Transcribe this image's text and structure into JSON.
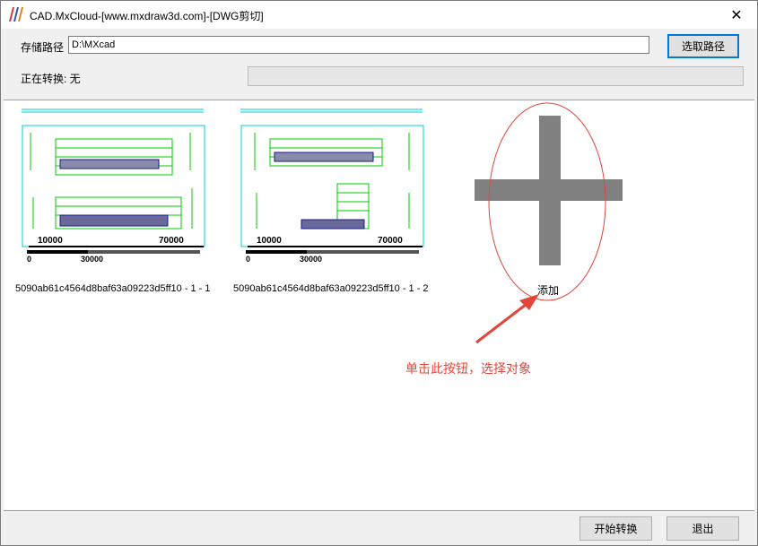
{
  "window": {
    "title": "CAD.MxCloud-[www.mxdraw3d.com]-[DWG剪切]",
    "close_glyph": "✕"
  },
  "storage": {
    "label": "存储路径",
    "value": "D:\\MXcad",
    "browse_label": "选取路径"
  },
  "status": {
    "text": "正在转换: 无"
  },
  "thumbnails": [
    {
      "caption": "5090ab61c4564d8baf63a09223d5ff10 - 1 - 1",
      "scale_left": "10000",
      "scale_right": "70000",
      "bar_start": "0",
      "bar_end": "30000"
    },
    {
      "caption": "5090ab61c4564d8baf63a09223d5ff10 - 1 - 2",
      "scale_left": "10000",
      "scale_right": "70000",
      "bar_start": "0",
      "bar_end": "30000"
    }
  ],
  "add": {
    "label": "添加",
    "icon": "plus-icon"
  },
  "annotation": {
    "text": "单击此按钮，选择对象",
    "color": "#e2453a"
  },
  "footer": {
    "start_label": "开始转换",
    "exit_label": "退出"
  },
  "colors": {
    "accent": "#0078d7",
    "cad_cyan": "#00d0d0",
    "cad_green": "#00cc00",
    "plus_gray": "#808080"
  }
}
